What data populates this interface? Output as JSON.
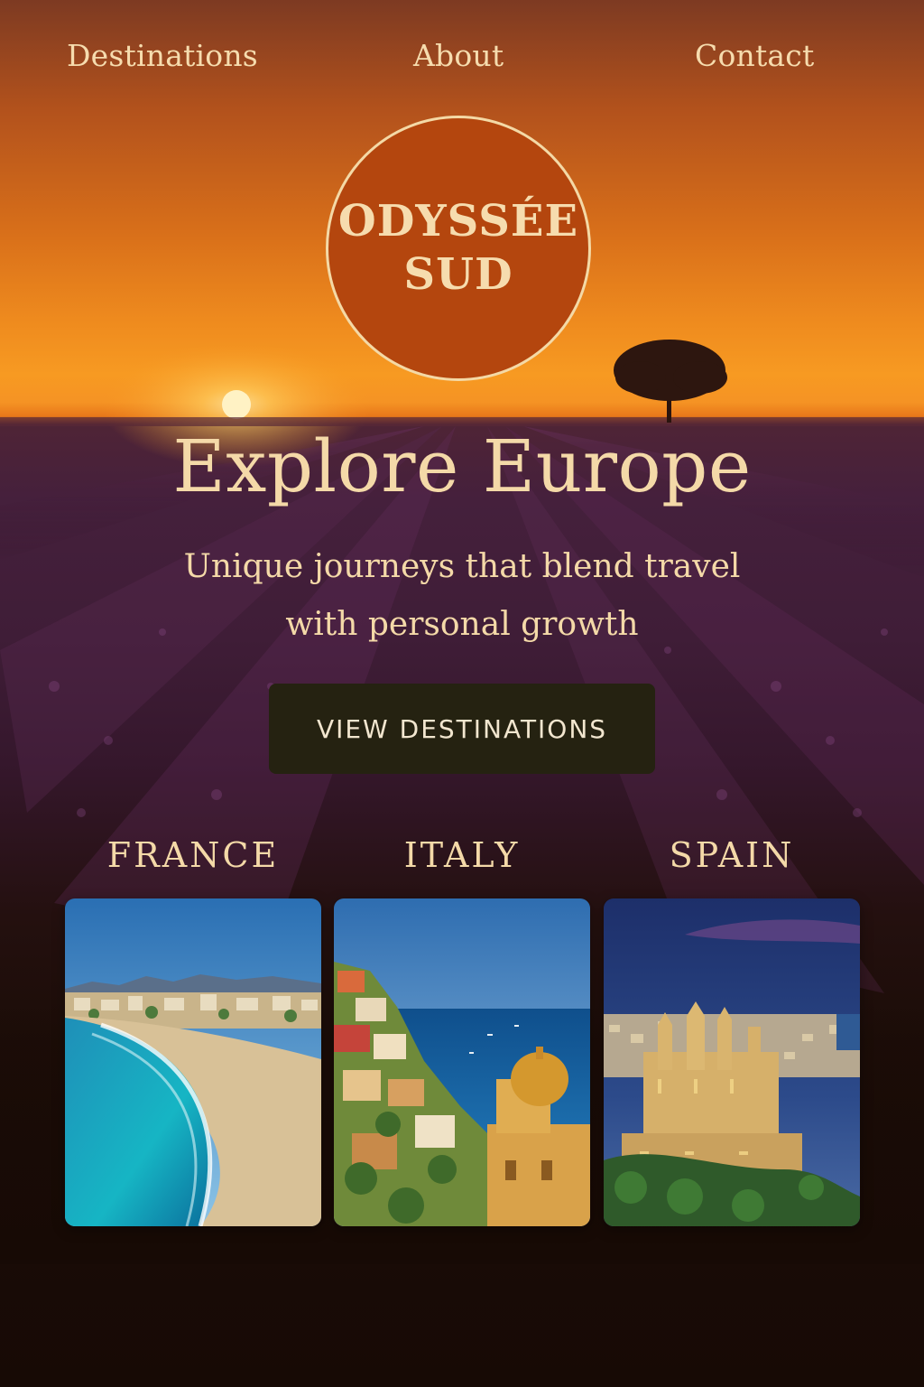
{
  "nav": {
    "links": [
      "Destinations",
      "About",
      "Contact"
    ]
  },
  "logo": {
    "line1": "ODYSSÉE",
    "line2": "SUD"
  },
  "hero": {
    "title": "Explore Europe",
    "subtitle_line1": "Unique journeys that blend travel",
    "subtitle_line2": "with personal growth"
  },
  "cta": {
    "label": "VIEW DESTINATIONS"
  },
  "destinations": [
    {
      "name": "FRANCE"
    },
    {
      "name": "ITALY"
    },
    {
      "name": "SPAIN"
    }
  ],
  "colors": {
    "accent_text": "#f4d9a8",
    "logo_fill": "#b4460e",
    "button_bg": "#252211",
    "sky_orange": "#f79a22",
    "lavender": "#4a2340"
  }
}
